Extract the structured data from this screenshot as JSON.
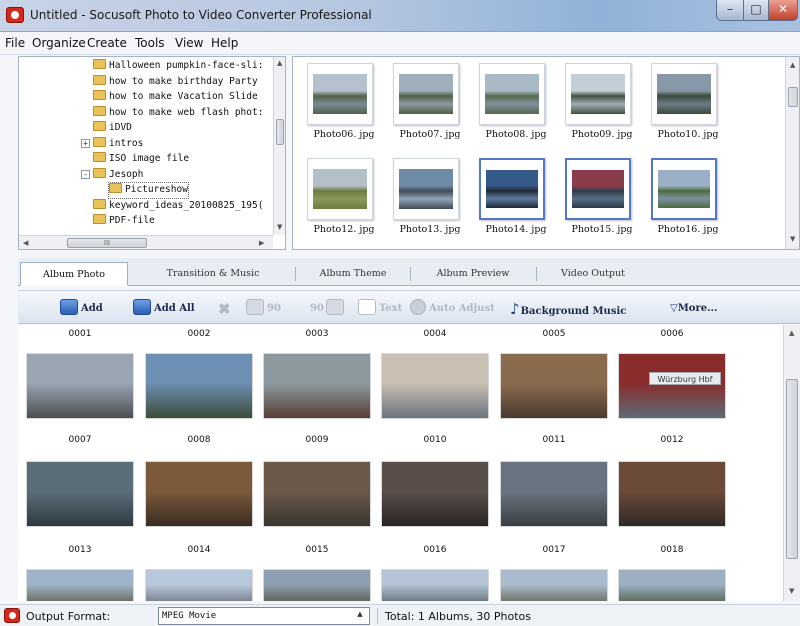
{
  "window": {
    "title": "Untitled - Socusoft Photo to Video Converter Professional"
  },
  "menu": [
    "File",
    "Organize",
    "Create",
    "Tools",
    "View",
    "Help"
  ],
  "tree": [
    {
      "label": "Halloween pumpkin-face-sli:",
      "expander": ""
    },
    {
      "label": "how to make birthday  Party",
      "expander": ""
    },
    {
      "label": "how to make Vacation Slide",
      "expander": ""
    },
    {
      "label": "how to make web flash phot:",
      "expander": ""
    },
    {
      "label": "iDVD",
      "expander": ""
    },
    {
      "label": "intros",
      "expander": "+"
    },
    {
      "label": "ISO image file",
      "expander": ""
    },
    {
      "label": "Jesoph",
      "expander": "-"
    },
    {
      "label": "Pictureshow",
      "expander": ""
    },
    {
      "label": "keyword_ideas_20100825_195(",
      "expander": ""
    },
    {
      "label": "PDF-file",
      "expander": ""
    }
  ],
  "tree_scroll": {
    "h_thumb_text": "III"
  },
  "browser_thumbs": [
    {
      "caption": "Photo06. jpg",
      "selected": false,
      "sky": "#b5c1cc",
      "land": "#526048",
      "water": "#7a8c96"
    },
    {
      "caption": "Photo07. jpg",
      "selected": false,
      "sky": "#9fb0bb",
      "land": "#4d6045",
      "water": "#8c9aa0"
    },
    {
      "caption": "Photo08. jpg",
      "selected": false,
      "sky": "#a9bac6",
      "land": "#566a4c",
      "water": "#7e909c"
    },
    {
      "caption": "Photo09. jpg",
      "selected": false,
      "sky": "#c4ced6",
      "land": "#40533f",
      "water": "#a0acb2"
    },
    {
      "caption": "Photo10. jpg",
      "selected": false,
      "sky": "#8798a8",
      "land": "#3b4b3a",
      "water": "#6b7b86"
    },
    {
      "caption": "Photo12. jpg",
      "selected": false,
      "sky": "#b3c0c8",
      "land": "#6b7c3e",
      "water": "#8b9a5c"
    },
    {
      "caption": "Photo13. jpg",
      "selected": false,
      "sky": "#6d8aa6",
      "land": "#3f4b58",
      "water": "#90a4b6"
    },
    {
      "caption": "Photo14. jpg",
      "selected": true,
      "sky": "#345a8a",
      "land": "#222a33",
      "water": "#5c7aa0"
    },
    {
      "caption": "Photo15. jpg",
      "selected": true,
      "sky": "#8a3c4a",
      "land": "#2c3b4a",
      "water": "#5a6e82"
    },
    {
      "caption": "Photo16. jpg",
      "selected": true,
      "sky": "#9bb0c4",
      "land": "#4f6a3c",
      "water": "#7a909e"
    }
  ],
  "tabs": [
    "Album Photo",
    "Transition & Music",
    "Album Theme",
    "Album Preview",
    "Video Output"
  ],
  "toolbar": {
    "add": "Add",
    "add_all": "Add All",
    "rotate_left": "90",
    "rotate_right": "90",
    "text": "Text",
    "auto_adjust": "Auto Adjust",
    "background_music": "Background Music",
    "more": "More..."
  },
  "album_rows": [
    {
      "labels_above": [
        "0001",
        "0002",
        "0003",
        "0004",
        "0005",
        "0006"
      ]
    },
    {
      "labels_below": [
        "0007",
        "0008",
        "0009",
        "0010",
        "0011",
        "0012"
      ]
    },
    {
      "labels_below": [
        "0013",
        "0014",
        "0015",
        "0016",
        "0017",
        "0018"
      ]
    }
  ],
  "album_photos": [
    {
      "top": "#9aa6b2",
      "bottom": "#4a4e52"
    },
    {
      "top": "#6d8fb3",
      "bottom": "#3d4d3a"
    },
    {
      "top": "#8c9aa0",
      "bottom": "#5a3d38"
    },
    {
      "top": "#c9bfb2",
      "bottom": "#6a7480"
    },
    {
      "top": "#8b6b4e",
      "bottom": "#4a3a30"
    },
    {
      "top": "#8a2c2c",
      "bottom": "#5d6a74"
    },
    {
      "top": "#5a6e7a",
      "bottom": "#2e3a40"
    },
    {
      "top": "#7b5a3a",
      "bottom": "#3a2c22"
    },
    {
      "top": "#6b5a4a",
      "bottom": "#3a3630"
    },
    {
      "top": "#5a4e4a",
      "bottom": "#2a2422"
    },
    {
      "top": "#6a7480",
      "bottom": "#3a3e44"
    },
    {
      "top": "#6b4a3a",
      "bottom": "#2e2a26"
    },
    {
      "top": "#9fb4c8",
      "bottom": "#6a6e62"
    },
    {
      "top": "#b8c8dc",
      "bottom": "#7a8290"
    },
    {
      "top": "#8ea0b0",
      "bottom": "#5e6458"
    },
    {
      "top": "#b4c4d6",
      "bottom": "#6a7880"
    },
    {
      "top": "#aabccc",
      "bottom": "#6e7468"
    },
    {
      "top": "#9cb0c2",
      "bottom": "#5e6a5a"
    }
  ],
  "wurzburg_sign": "Würzburg Hbf",
  "status": {
    "label": "Output Format:",
    "format": "MPEG Movie",
    "total": "Total: 1 Albums, 30 Photos"
  }
}
